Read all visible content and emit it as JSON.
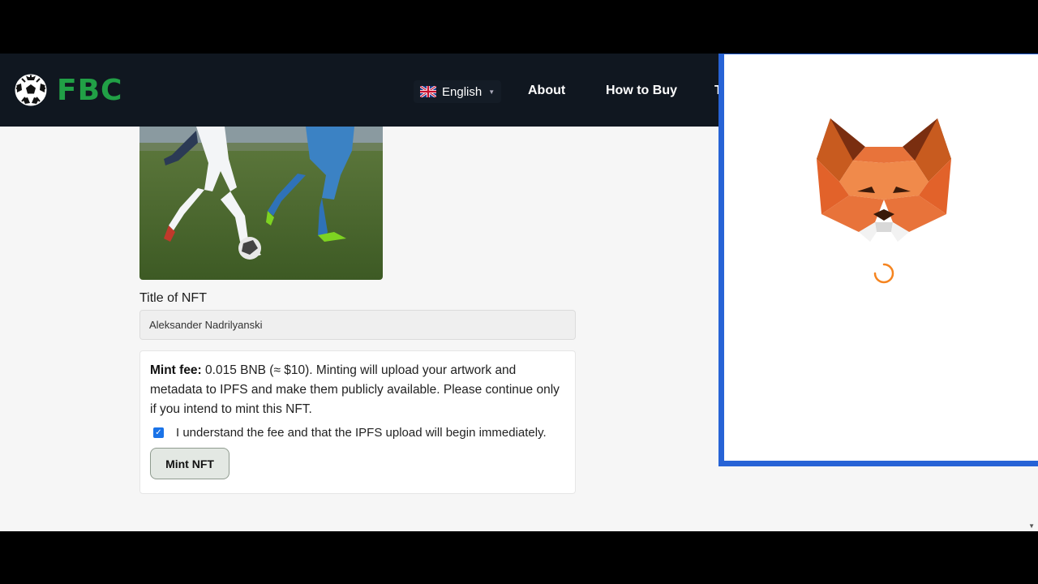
{
  "navbar": {
    "brand": "FBC",
    "logo_icon": "soccer-ball-icon",
    "language": {
      "label": "English",
      "flag_icon": "uk-flag-icon"
    },
    "links": {
      "about": "About",
      "how_to_buy": "How to Buy",
      "extra": "T"
    }
  },
  "form": {
    "image_alt_icon": "soccer-players-photo",
    "title_label": "Title of NFT",
    "title_value": "Aleksander Nadrilyanski",
    "fee_label": "Mint fee:",
    "fee_text": " 0.015 BNB (≈ $10). Minting will upload your artwork and metadata to IPFS and make them publicly available. Please continue only if you intend to mint this NFT.",
    "consent_checked": true,
    "consent_text": "I understand the fee and that the IPFS upload will begin immediately.",
    "mint_button": "Mint NFT"
  },
  "wallet_popup": {
    "logo_icon": "metamask-fox-icon",
    "status_icon": "loading-spinner-icon"
  },
  "colors": {
    "accent": "#21a046",
    "popup_border": "#2763d6",
    "nav_bg": "#101720"
  }
}
